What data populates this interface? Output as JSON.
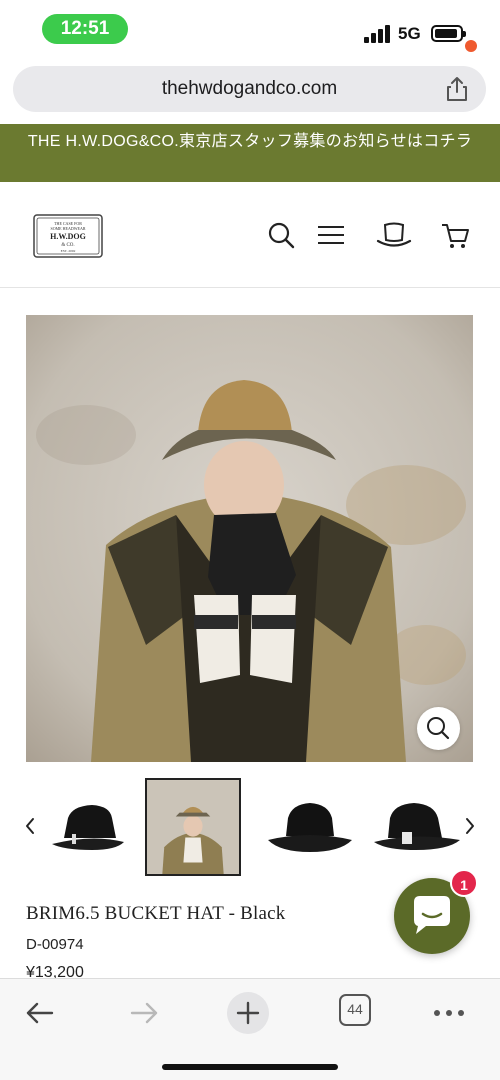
{
  "status_bar": {
    "time": "12:51",
    "network": "5G"
  },
  "browser": {
    "url": "thehwdogandco.com",
    "tab_count": "44"
  },
  "announcement": {
    "text": "THE H.W.DOG&CO.東京店スタッフ募集のお知らせはコチラ"
  },
  "header": {
    "logo_text": {
      "top": "THE CASE FOR",
      "line2": "SOME HEADWEAR",
      "brand": "H.W.DOG",
      "co": "& CO.",
      "est": "EST. 2002"
    },
    "icons": [
      "search-icon",
      "menu-icon",
      "hat-icon",
      "cart-icon"
    ]
  },
  "product": {
    "title": "BRIM6.5 BUCKET HAT - Black",
    "sku": "D-00974",
    "price": "¥13,200"
  },
  "chat": {
    "badge_count": "1"
  },
  "colors": {
    "announcement_bg": "#6b7a30",
    "chat_bg": "#5b6a28",
    "badge": "#e3264b",
    "cart_dot": "#ef5a2f",
    "time_pill": "#3ccb4c"
  }
}
